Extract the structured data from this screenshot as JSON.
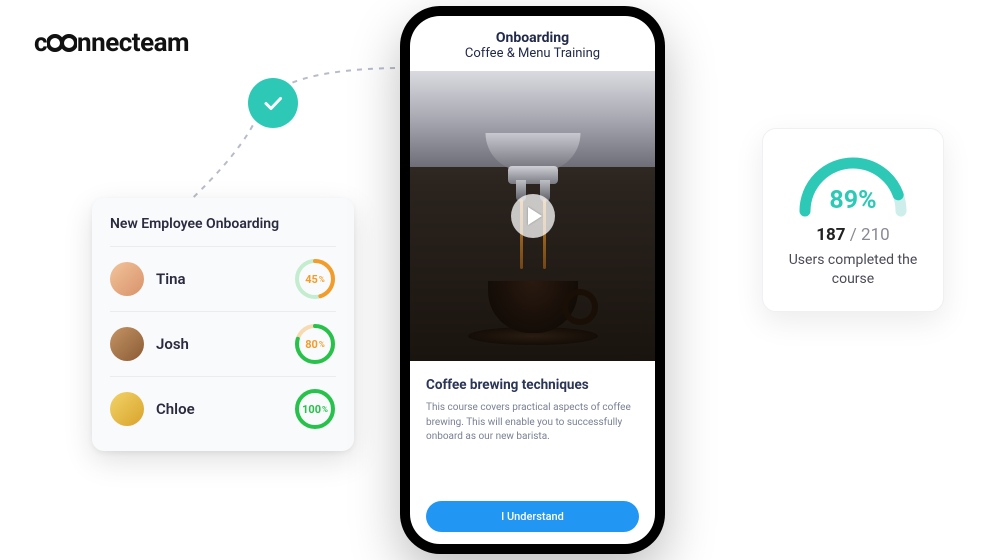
{
  "brand": {
    "name": "connecteam"
  },
  "employee_card": {
    "title": "New Employee Onboarding",
    "rows": [
      {
        "name": "Tina",
        "percent": 45,
        "label": "45",
        "color": "#f39c2a",
        "text_color": "#f39c2a"
      },
      {
        "name": "Josh",
        "percent": 80,
        "label": "80",
        "color": "#27c24c",
        "text_color": "#f39c2a"
      },
      {
        "name": "Chloe",
        "percent": 100,
        "label": "100",
        "color": "#27c24c",
        "text_color": "#27c24c"
      }
    ]
  },
  "phone": {
    "header_title": "Onboarding",
    "header_subtitle": "Coffee & Menu Training",
    "course_title": "Coffee brewing techniques",
    "course_desc": "This course covers practical aspects of coffee brewing. This will enable you to successfully onboard as our new barista.",
    "cta": "I Understand"
  },
  "completion": {
    "percent": 89,
    "percent_label": "89%",
    "done": "187",
    "sep": " / ",
    "total": "210",
    "subtitle": "Users completed the course"
  },
  "avatar_bg": {
    "tina": "linear-gradient(135deg,#f2c49b,#d8926a)",
    "josh": "linear-gradient(135deg,#c59566,#8a5a34)",
    "chloe": "linear-gradient(135deg,#f2d36a,#d8a32a)"
  }
}
